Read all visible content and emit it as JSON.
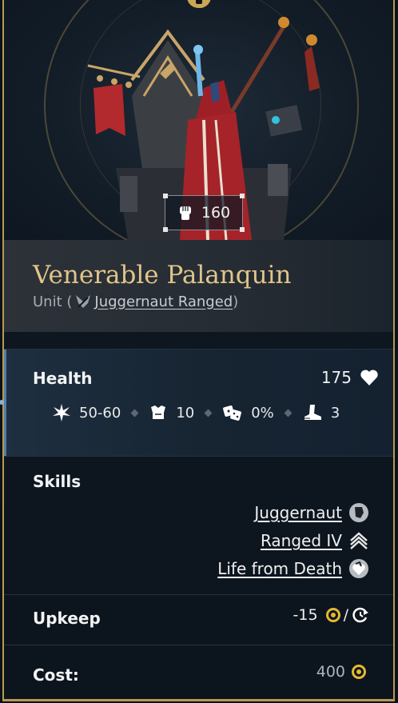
{
  "unit": {
    "power": "160",
    "name": "Venerable Palanquin",
    "type_prefix": "Unit (",
    "type_link": "Juggernaut Ranged",
    "type_suffix": ")"
  },
  "health": {
    "label": "Health",
    "value": "175",
    "damage": "50-60",
    "defense": "10",
    "chance": "0%",
    "movement": "3"
  },
  "skills": {
    "label": "Skills",
    "items": [
      "Juggernaut",
      "Ranged IV",
      "Life from Death"
    ]
  },
  "upkeep": {
    "label": "Upkeep",
    "value": "-15",
    "slash": "/"
  },
  "cost": {
    "label": "Cost:",
    "value": "400"
  },
  "colors": {
    "gold": "#b89a52",
    "title": "#e1c58a",
    "coin": "#e3b931"
  }
}
